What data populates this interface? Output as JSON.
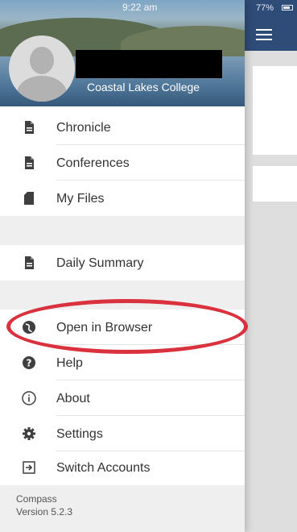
{
  "status_bar": {
    "time": "9:22 am",
    "battery": "77%"
  },
  "header": {
    "college_name": "Coastal Lakes College"
  },
  "menu": {
    "group1": [
      {
        "label": "Chronicle",
        "icon": "document-icon"
      },
      {
        "label": "Conferences",
        "icon": "document-icon"
      },
      {
        "label": "My Files",
        "icon": "sd-card-icon"
      }
    ],
    "group2": [
      {
        "label": "Daily Summary",
        "icon": "document-icon"
      }
    ],
    "group3": [
      {
        "label": "Open in Browser",
        "icon": "globe-icon"
      },
      {
        "label": "Help",
        "icon": "help-circle-icon"
      },
      {
        "label": "About",
        "icon": "info-icon"
      },
      {
        "label": "Settings",
        "icon": "gear-icon"
      },
      {
        "label": "Switch Accounts",
        "icon": "switch-account-icon"
      }
    ]
  },
  "footer": {
    "app_name": "Compass",
    "version": "Version 5.2.3"
  },
  "colors": {
    "topbar": "#2f4b77",
    "highlight": "#d9313d",
    "section_bg": "#efefef"
  }
}
